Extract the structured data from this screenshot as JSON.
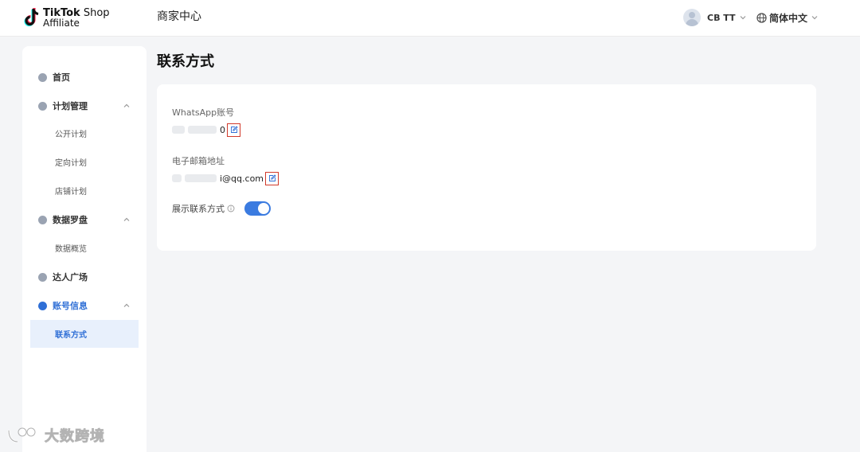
{
  "header": {
    "logo_line1_bold": "TikTok",
    "logo_line1_rest": "Shop",
    "logo_line2": "Affiliate",
    "center_title": "商家中心",
    "user_name": "CB TT",
    "language": "简体中文"
  },
  "sidebar": {
    "items": [
      {
        "label": "首页",
        "icon": "home-icon"
      },
      {
        "label": "计划管理",
        "icon": "plan-icon",
        "expanded": true
      },
      {
        "label": "公开计划"
      },
      {
        "label": "定向计划"
      },
      {
        "label": "店铺计划"
      },
      {
        "label": "数据罗盘",
        "icon": "compass-icon",
        "expanded": true
      },
      {
        "label": "数据概览"
      },
      {
        "label": "达人广场",
        "icon": "creator-icon"
      },
      {
        "label": "账号信息",
        "icon": "account-icon",
        "expanded": true,
        "active": true
      },
      {
        "label": "联系方式",
        "selected": true
      }
    ]
  },
  "main": {
    "page_title": "联系方式",
    "whatsapp_label": "WhatsApp账号",
    "whatsapp_value_visible": "0",
    "email_label": "电子邮箱地址",
    "email_value_visible": "i@qq.com",
    "show_contact_label": "展示联系方式",
    "show_contact_enabled": true
  },
  "colors": {
    "accent": "#3b7be0",
    "highlight_box": "#d13a2b",
    "page_background": "#f4f5f7"
  },
  "watermark": {
    "text": "大数跨境"
  }
}
